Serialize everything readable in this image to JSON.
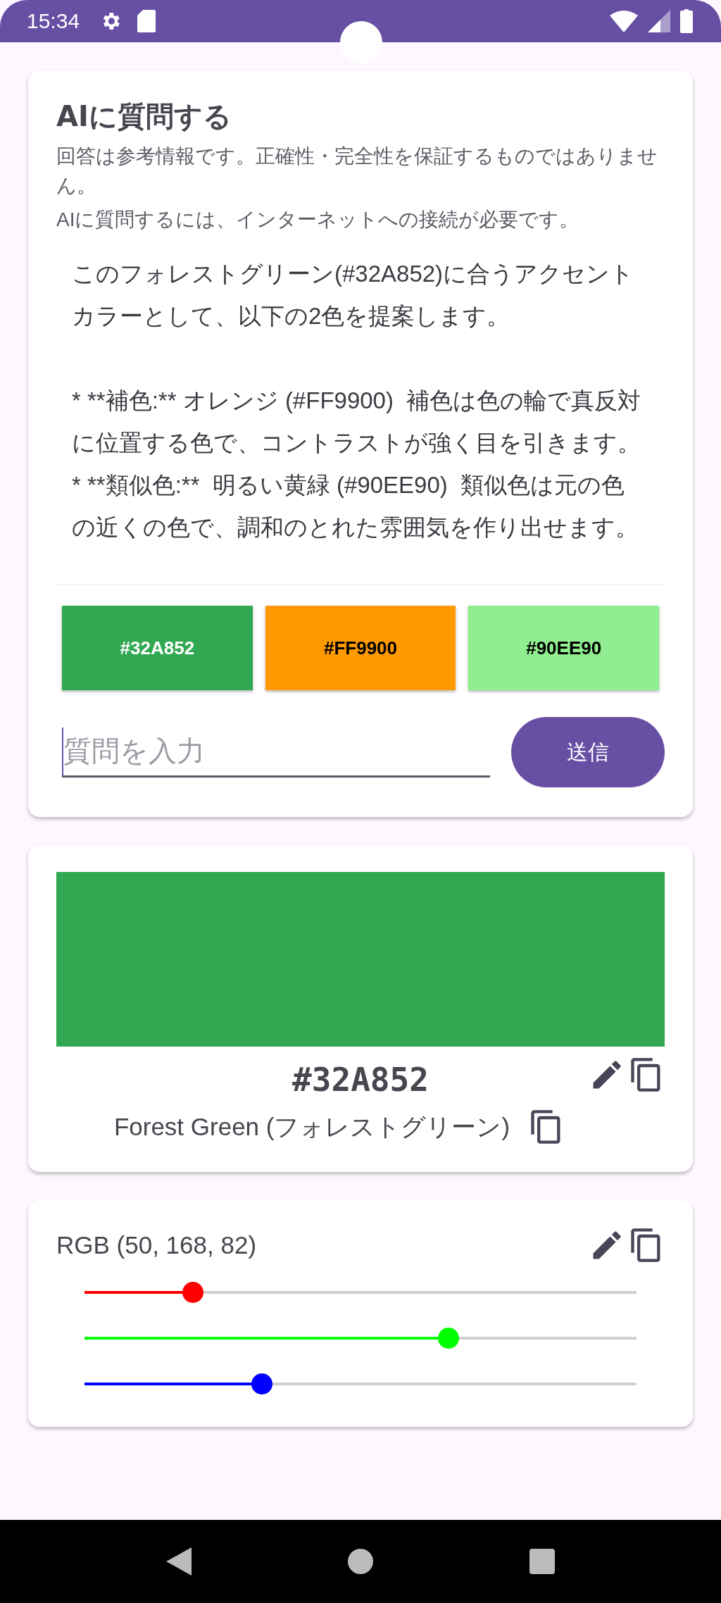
{
  "status_bar": {
    "time": "15:34"
  },
  "ai_card": {
    "title": "AIに質問する",
    "disclaimer": "回答は参考情報です。正確性・完全性を保証するものではありません。",
    "notice": "AIに質問するには、インターネットへの接続が必要です。",
    "answer": [
      "このフォレストグリーン(#32A852)に合うアクセントカラーとして、以下の2色を提案します。",
      "* **補色:** オレンジ (#FF9900)  補色は色の輪で真反対に位置する色で、コントラストが強く目を引きます。\n* **類似色:**  明るい黄緑 (#90EE90)  類似色は元の色の近くの色で、調和のとれた雰囲気を作り出せます。"
    ],
    "swatches": [
      {
        "label": "#32A852",
        "color": "#32a852"
      },
      {
        "label": "#FF9900",
        "color": "#ff9900"
      },
      {
        "label": "#90EE90",
        "color": "#90ee90"
      }
    ],
    "input": {
      "placeholder": "質問を入力"
    },
    "send_button": "送信"
  },
  "color_card": {
    "color": "#32a852",
    "hex": "#32A852",
    "name": "Forest Green (フォレストグリーン)"
  },
  "rgb_card": {
    "label": "RGB (50, 168, 82)",
    "sliders": [
      {
        "color": "#ff0000",
        "level": 0.196
      },
      {
        "color": "#00ff00",
        "level": 0.659
      },
      {
        "color": "#0000ff",
        "level": 0.322
      }
    ]
  }
}
